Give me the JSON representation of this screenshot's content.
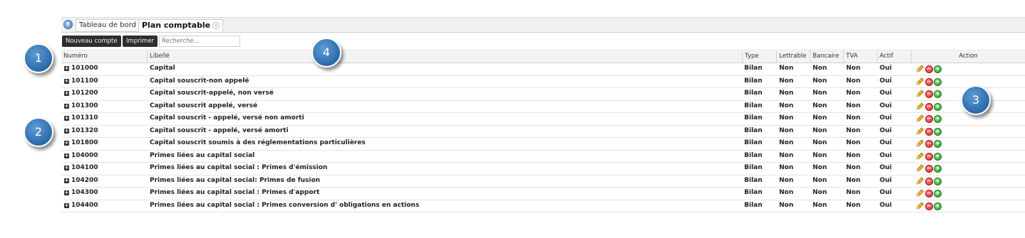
{
  "tabs": [
    {
      "label": "Tableau de bord",
      "active": false
    },
    {
      "label": "Plan comptable",
      "active": true
    }
  ],
  "toolbar": {
    "new_account_label": "Nouveau compte",
    "print_label": "Imprimer",
    "search_placeholder": "Recherche..."
  },
  "columns": {
    "numero": "Numéro",
    "libelle": "Libellé",
    "type": "Type",
    "lettrable": "Lettrable",
    "bancaire": "Bancaire",
    "tva": "TVA",
    "actif": "Actif",
    "action": "Action"
  },
  "rows": [
    {
      "numero": "101000",
      "libelle": "Capital",
      "type": "Bilan",
      "lettrable": "Non",
      "bancaire": "Non",
      "tva": "Non",
      "actif": "Oui"
    },
    {
      "numero": "101100",
      "libelle": "Capital souscrit-non appelé",
      "type": "Bilan",
      "lettrable": "Non",
      "bancaire": "Non",
      "tva": "Non",
      "actif": "Oui"
    },
    {
      "numero": "101200",
      "libelle": "Capital souscrit-appelé, non versé",
      "type": "Bilan",
      "lettrable": "Non",
      "bancaire": "Non",
      "tva": "Non",
      "actif": "Oui"
    },
    {
      "numero": "101300",
      "libelle": "Capital souscrit appelé, versé",
      "type": "Bilan",
      "lettrable": "Non",
      "bancaire": "Non",
      "tva": "Non",
      "actif": "Oui"
    },
    {
      "numero": "101310",
      "libelle": "Capital souscrit - appelé, versé non amorti",
      "type": "Bilan",
      "lettrable": "Non",
      "bancaire": "Non",
      "tva": "Non",
      "actif": "Oui"
    },
    {
      "numero": "101320",
      "libelle": "Capital souscrit - appelé, versé amorti",
      "type": "Bilan",
      "lettrable": "Non",
      "bancaire": "Non",
      "tva": "Non",
      "actif": "Oui"
    },
    {
      "numero": "101800",
      "libelle": "Capital souscrit soumis à des réglementations particulières",
      "type": "Bilan",
      "lettrable": "Non",
      "bancaire": "Non",
      "tva": "Non",
      "actif": "Oui"
    },
    {
      "numero": "104000",
      "libelle": "Primes liées au capital social",
      "type": "Bilan",
      "lettrable": "Non",
      "bancaire": "Non",
      "tva": "Non",
      "actif": "Oui"
    },
    {
      "numero": "104100",
      "libelle": "Primes liées au capital social : Primes d'émission",
      "type": "Bilan",
      "lettrable": "Non",
      "bancaire": "Non",
      "tva": "Non",
      "actif": "Oui"
    },
    {
      "numero": "104200",
      "libelle": "Primes liées au capital social: Primes de fusion",
      "type": "Bilan",
      "lettrable": "Non",
      "bancaire": "Non",
      "tva": "Non",
      "actif": "Oui"
    },
    {
      "numero": "104300",
      "libelle": "Primes liées au capital social : Primes d'apport",
      "type": "Bilan",
      "lettrable": "Non",
      "bancaire": "Non",
      "tva": "Non",
      "actif": "Oui"
    },
    {
      "numero": "104400",
      "libelle": "Primes liées au capital social : Primes conversion d' obligations en actions",
      "type": "Bilan",
      "lettrable": "Non",
      "bancaire": "Non",
      "tva": "Non",
      "actif": "Oui"
    }
  ],
  "row_actions": [
    "pencil-icon",
    "remove-icon",
    "add-icon"
  ],
  "callouts": [
    "1",
    "2",
    "3",
    "4"
  ],
  "colors": {
    "button_bg": "#2e2e2e",
    "callout_blue": "#2b6aa8",
    "remove_red": "#d62020",
    "add_green": "#1e9a1e"
  }
}
